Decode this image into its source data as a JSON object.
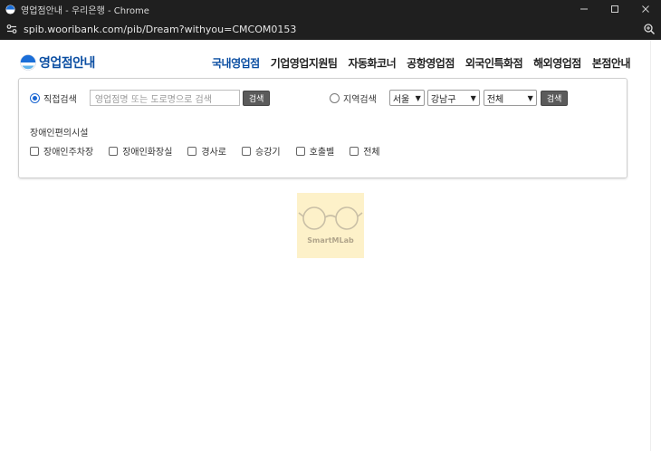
{
  "window": {
    "title": "영업점안내 - 우리은행 - Chrome",
    "url": "spib.wooribank.com/pib/Dream?withyou=CMCOM0153"
  },
  "logo": {
    "text": "영업점안내",
    "color": "#0b4ea2"
  },
  "nav": {
    "items": [
      "국내영업점",
      "기업영업지원팀",
      "자동화코너",
      "공항영업점",
      "외국인특화점",
      "해외영업점",
      "본점안내"
    ],
    "active_index": 0
  },
  "search": {
    "direct_label": "직접검색",
    "direct_checked": true,
    "placeholder": "영업점명 또는 도로명으로 검색",
    "button_label": "검색",
    "region_label": "지역검색",
    "region_checked": false,
    "city": "서울",
    "district": "강남구",
    "type": "전체",
    "region_button_label": "검색"
  },
  "facilities": {
    "label": "장애인편의시설",
    "items": [
      "장애인주차장",
      "장애인화장실",
      "경사로",
      "승강기",
      "호출벨",
      "전체"
    ]
  },
  "watermark": {
    "text": "SmartMLab"
  }
}
